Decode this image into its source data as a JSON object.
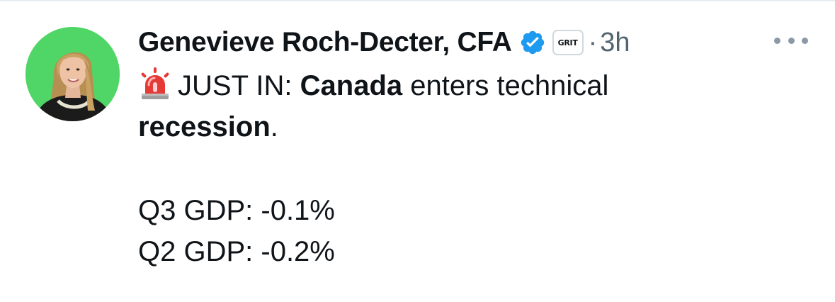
{
  "tweet": {
    "author": {
      "display_name": "Genevieve Roch-Decter, CFA",
      "verified": true,
      "affiliate_badge": "GRIT",
      "avatar_bg": "#4fd666"
    },
    "separator": "·",
    "timestamp": "3h",
    "more_icon": "ellipsis-icon",
    "body": {
      "siren_icon": "rotating-light-emoji",
      "line1_prefix": "JUST IN: ",
      "line1_bold": "Canada",
      "line1_suffix": " enters technical",
      "line2_bold": "recession",
      "line2_suffix": ".",
      "gdp_q3": "Q3 GDP: -0.1%",
      "gdp_q2": "Q2 GDP: -0.2%"
    }
  },
  "colors": {
    "verified_blue": "#1d9bf0",
    "secondary_text": "#536471",
    "primary_text": "#0f1419"
  }
}
